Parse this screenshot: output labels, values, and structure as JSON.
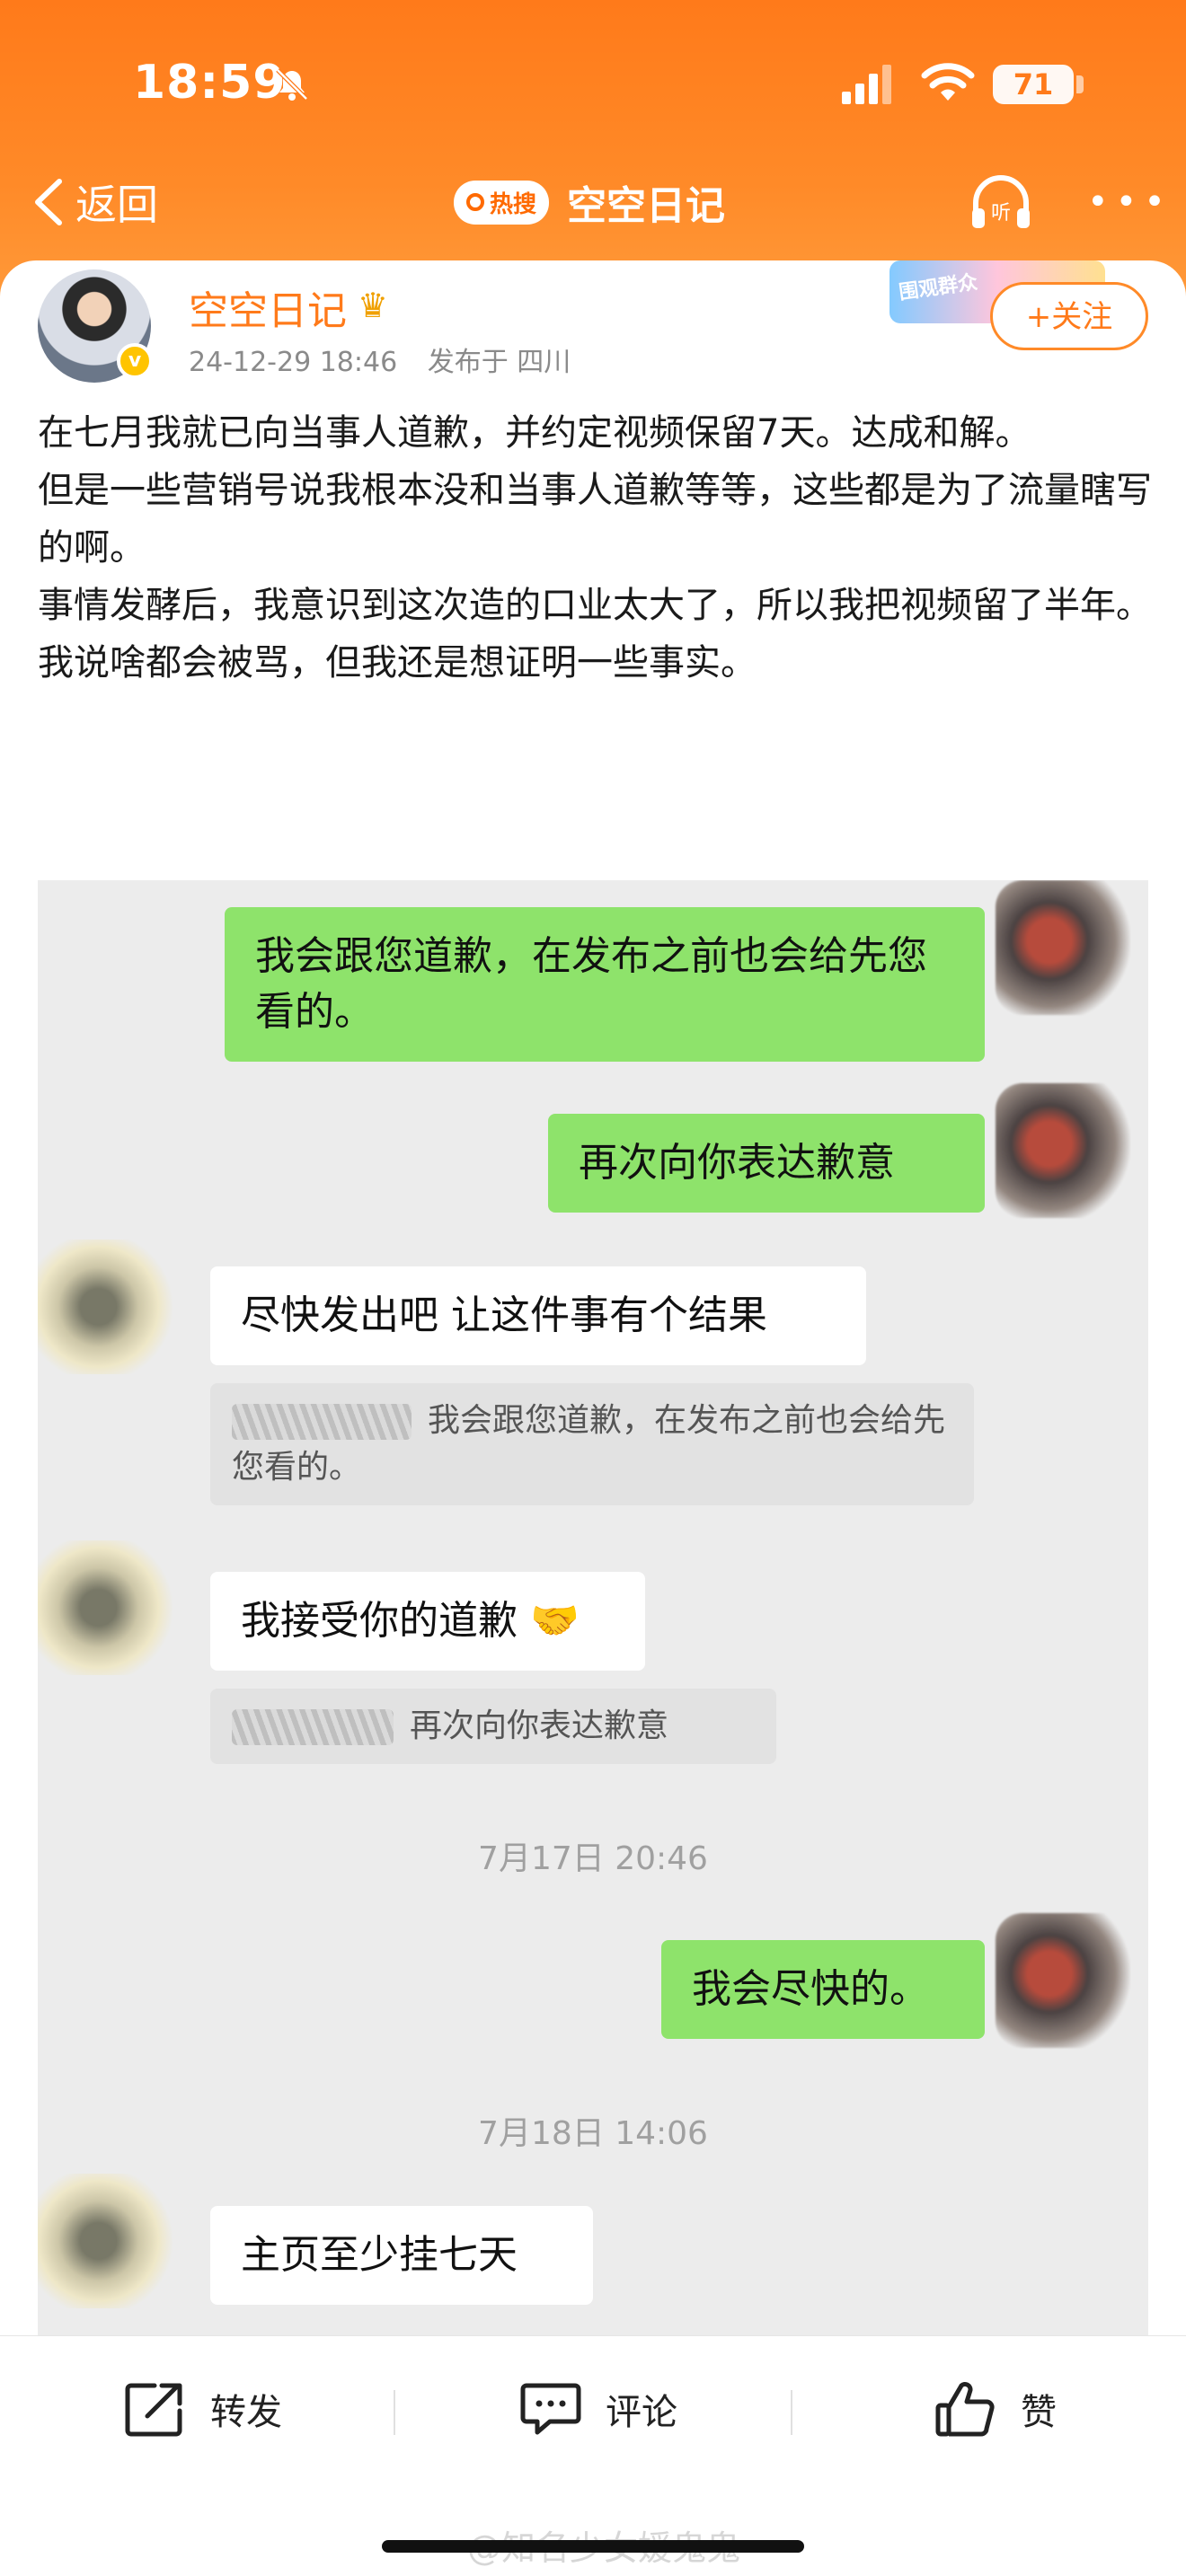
{
  "status_bar": {
    "time": "18:59",
    "battery": "71"
  },
  "nav": {
    "back_label": "返回",
    "hot_badge": "热搜",
    "title": "空空日记"
  },
  "post": {
    "author": "空空日记",
    "verified_mark": "v",
    "date": "24-12-29 18:46",
    "location": "发布于 四川",
    "deco_text": "围观群众",
    "follow_label": "+关注",
    "paragraphs": [
      "在七月我就已向当事人道歉，并约定视频保留7天。达成和解。",
      "但是一些营销号说我根本没和当事人道歉等等，这些都是为了流量瞎写的啊。",
      "事情发酵后，我意识到这次造的口业太大了，所以我把视频留了半年。我说啥都会被骂，但我还是想证明一些事实。"
    ]
  },
  "chat": {
    "messages": [
      {
        "text": "我会跟您道歉，在发布之前也会给先您看的。"
      },
      {
        "text": "再次向你表达歉意"
      },
      {
        "text": "尽快发出吧 让这件事有个结果"
      },
      {
        "text": "我会跟您道歉，在发布之前也会给先您看的。"
      },
      {
        "text": "我接受你的道歉 🤝"
      },
      {
        "text": "再次向你表达歉意"
      },
      {
        "text": "7月17日 20:46"
      },
      {
        "text": "我会尽快的。"
      },
      {
        "text": "7月18日 14:06"
      },
      {
        "text": "主页至少挂七天"
      }
    ]
  },
  "actions": {
    "repost": "转发",
    "comment": "评论",
    "like": "赞"
  },
  "watermark": "@知名少女媛鬼鬼"
}
